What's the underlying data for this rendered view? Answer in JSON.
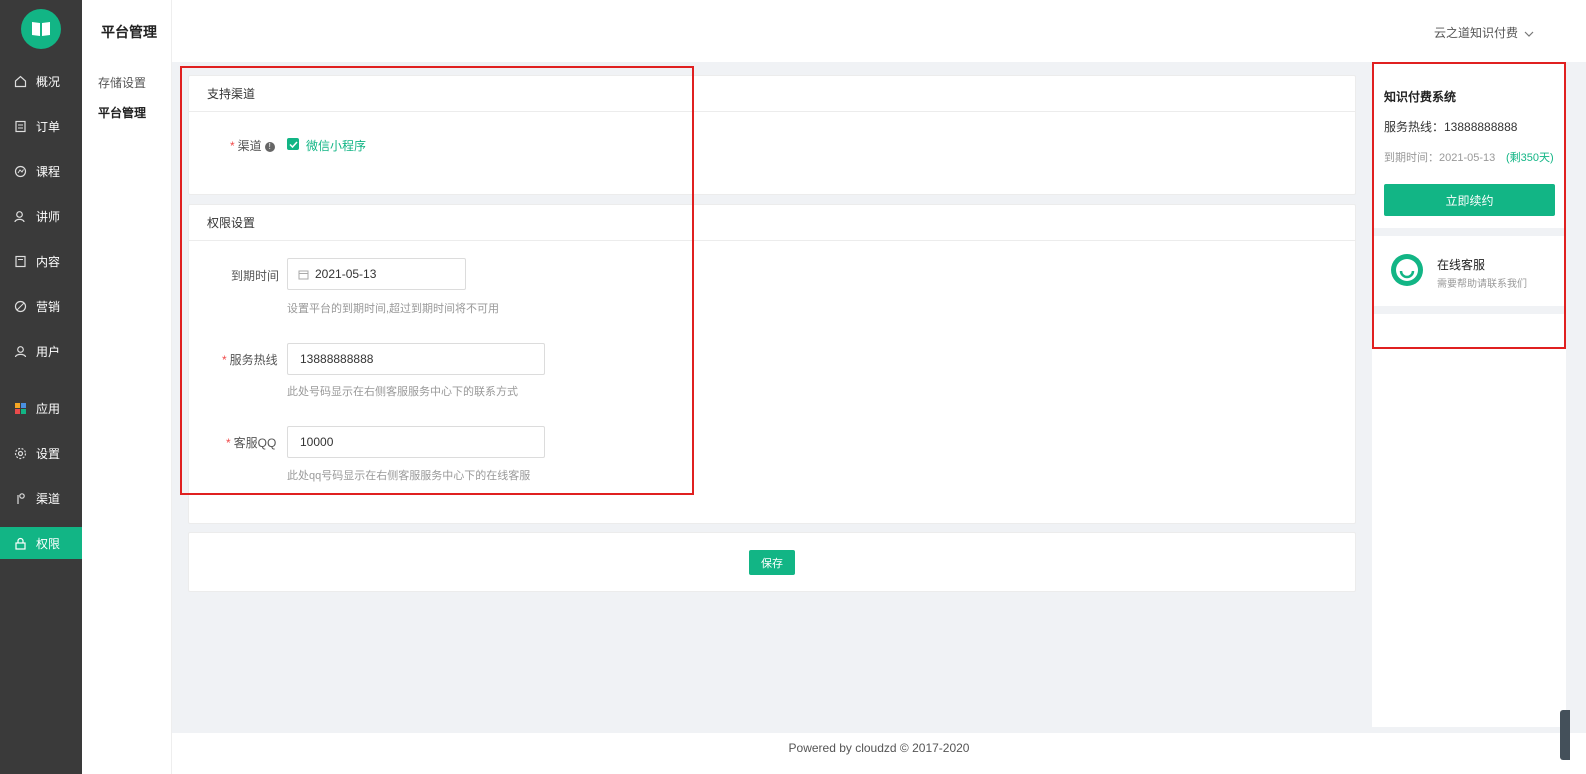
{
  "sidebar": {
    "logo_icon": "book-icon",
    "items": [
      {
        "label": "概况",
        "icon": "home-icon"
      },
      {
        "label": "订单",
        "icon": "order-icon"
      },
      {
        "label": "课程",
        "icon": "course-icon"
      },
      {
        "label": "讲师",
        "icon": "teacher-icon"
      },
      {
        "label": "内容",
        "icon": "content-icon"
      },
      {
        "label": "营销",
        "icon": "marketing-icon"
      },
      {
        "label": "用户",
        "icon": "user-icon"
      },
      {
        "label": "应用",
        "icon": "apps-icon"
      },
      {
        "label": "设置",
        "icon": "gear-icon"
      },
      {
        "label": "渠道",
        "icon": "channel-icon"
      },
      {
        "label": "权限",
        "icon": "lock-icon",
        "active": true
      }
    ]
  },
  "subnav": {
    "title": "平台管理",
    "items": [
      {
        "label": "存储设置"
      },
      {
        "label": "平台管理",
        "active": true
      }
    ]
  },
  "header": {
    "user_menu": "云之道知识付费"
  },
  "channel_card": {
    "title": "支持渠道",
    "channel_label": "渠道",
    "channel_option": "微信小程序",
    "channel_checked": true
  },
  "permission_card": {
    "title": "权限设置",
    "expire_label": "到期时间",
    "expire_value": "2021-05-13",
    "expire_hint": "设置平台的到期时间,超过到期时间将不可用",
    "hotline_label": "服务热线",
    "hotline_value": "13888888888",
    "hotline_hint": "此处号码显示在右侧客服服务中心下的联系方式",
    "qq_label": "客服QQ",
    "qq_value": "10000",
    "qq_hint": "此处qq号码显示在右侧客服服务中心下的在线客服"
  },
  "actions": {
    "save_label": "保存"
  },
  "footer": {
    "text": "Powered by cloudzd © 2017-2020"
  },
  "right_panel": {
    "title": "知识付费系统",
    "hotline": "服务热线：13888888888",
    "expire": "到期时间：2021-05-13",
    "remaining": "(剩350天)",
    "renew_label": "立即续约",
    "cs_title": "在线客服",
    "cs_subtitle": "需要帮助请联系我们"
  },
  "colors": {
    "accent": "#12b585",
    "sidebar_bg": "#3a3a3a",
    "annotation_red": "#e02020"
  }
}
